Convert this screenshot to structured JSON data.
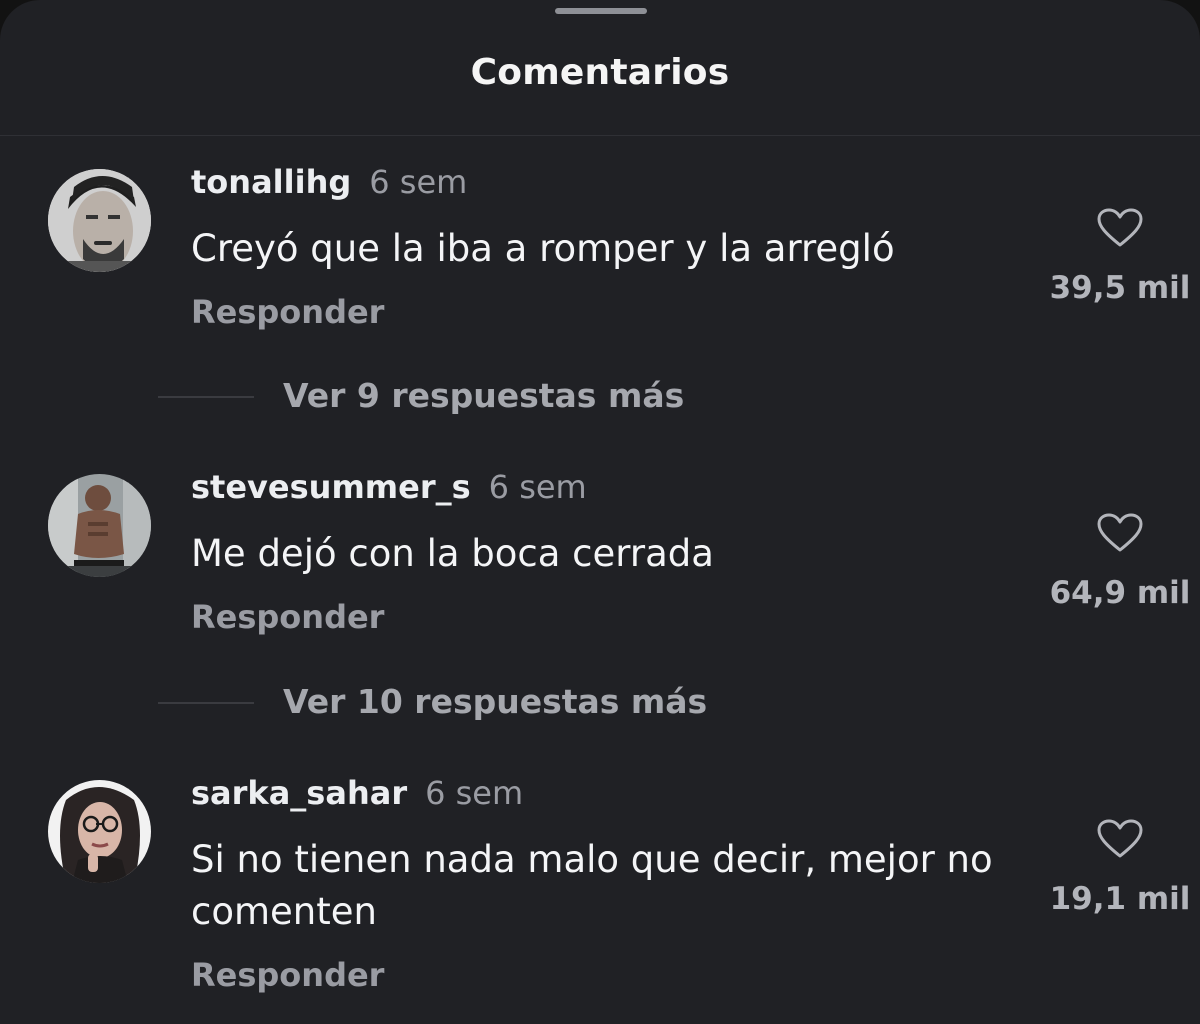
{
  "header": {
    "title": "Comentarios"
  },
  "comments": [
    {
      "username": "tonallihg",
      "time": "6 sem",
      "text": "Creyó que la iba a romper y la arregló",
      "reply_label": "Responder",
      "likes": "39,5 mil",
      "more_replies": "Ver 9 respuestas más"
    },
    {
      "username": "stevesummer_s",
      "time": "6 sem",
      "text": "Me dejó con la boca cerrada",
      "reply_label": "Responder",
      "likes": "64,9 mil",
      "more_replies": "Ver 10 respuestas más"
    },
    {
      "username": "sarka_sahar",
      "time": "6 sem",
      "text": "Si no tienen nada malo que decir, mejor no comenten",
      "reply_label": "Responder",
      "likes": "19,1 mil"
    }
  ],
  "icons": {
    "like": "heart-outline-icon"
  },
  "colors": {
    "background": "#202125",
    "text_primary": "#f4f5f7",
    "text_secondary": "#9a9ca3"
  }
}
